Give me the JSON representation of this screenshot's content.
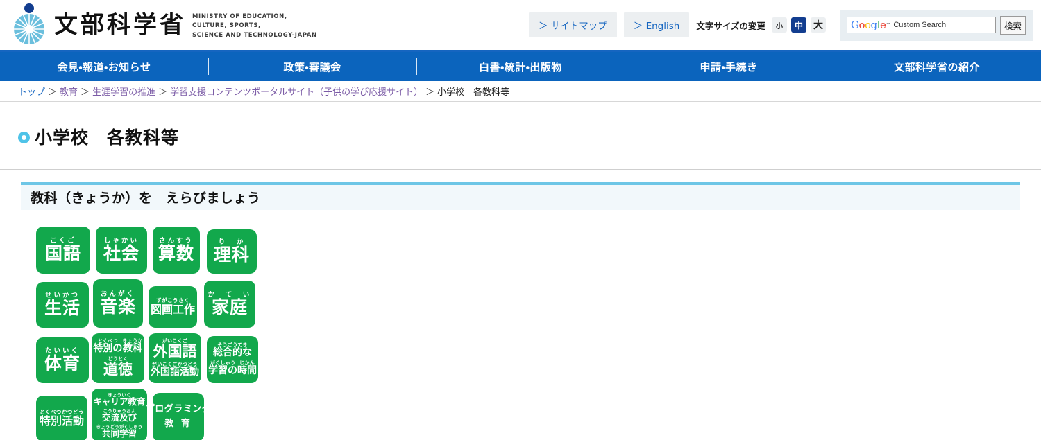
{
  "header": {
    "logo_jp": "文部科学省",
    "logo_en_lines": [
      "MINISTRY OF EDUCATION,",
      "CULTURE, SPORTS,",
      "SCIENCE AND TECHNOLOGY-JAPAN"
    ],
    "sitemap_label": "＞ サイトマップ",
    "english_label": "＞ English",
    "fontsize_label": "文字サイズの変更",
    "fontsize_options": [
      {
        "label": "小",
        "active": false
      },
      {
        "label": "中",
        "active": true
      },
      {
        "label": "大",
        "active": false
      }
    ],
    "search": {
      "brand": "Google",
      "trademark": "™",
      "custom_search_label": "Custom Search",
      "input_value": "",
      "placeholder": "",
      "button_label": "検索"
    },
    "accent_blue": "#0b64bd",
    "active_navy": "#123d8f"
  },
  "gnav": {
    "items": [
      {
        "label": "会見・報道・お知らせ"
      },
      {
        "label": "政策・審議会"
      },
      {
        "label": "白書・統計・出版物"
      },
      {
        "label": "申請・手続き"
      },
      {
        "label": "文部科学省の紹介"
      }
    ]
  },
  "breadcrumb": {
    "separator": "＞",
    "items": [
      {
        "label": "トップ",
        "link": true,
        "visited": false
      },
      {
        "label": "教育",
        "link": true,
        "visited": true
      },
      {
        "label": "生涯学習の推進",
        "link": true,
        "visited": true
      },
      {
        "label": "学習支援コンテンツポータルサイト（子供の学び応援サイト）",
        "link": true,
        "visited": true
      },
      {
        "label": "小学校　各教科等",
        "link": false,
        "visited": false
      }
    ]
  },
  "page": {
    "title": "小学校　各教科等",
    "section_heading": "教科（きょうか）を　えらびましょう",
    "tile_color": "#12a84c",
    "bullet_color": "#4fc3e8",
    "section_border_color": "#6ec6e6"
  },
  "subjects": {
    "rows": [
      [
        {
          "name": "国語",
          "ruby": "こくご",
          "width": 78,
          "height": 68,
          "size": "s-xl",
          "lines": [
            {
              "text": "国語",
              "ruby": "こくご"
            }
          ]
        },
        {
          "name": "社会",
          "ruby": "しゃかい",
          "width": 74,
          "height": 68,
          "size": "s-xl",
          "lines": [
            {
              "text": "社会",
              "ruby": "しゃかい"
            }
          ]
        },
        {
          "name": "算数",
          "ruby": "さんすう",
          "width": 68,
          "height": 68,
          "size": "s-xl",
          "lines": [
            {
              "text": "算数",
              "ruby": "さんすう"
            }
          ]
        },
        {
          "name": "理科",
          "ruby": "りか",
          "width": 72,
          "height": 64,
          "size": "s-xl",
          "lines": [
            {
              "text": "理科",
              "ruby": "り　か"
            }
          ]
        }
      ],
      [
        {
          "name": "生活",
          "ruby": "せいかつ",
          "width": 76,
          "height": 66,
          "size": "s-xl",
          "lines": [
            {
              "text": "生活",
              "ruby": "せいかつ"
            }
          ]
        },
        {
          "name": "音楽",
          "ruby": "おんがく",
          "width": 72,
          "height": 70,
          "size": "s-xl",
          "lines": [
            {
              "text": "音楽",
              "ruby": "おんがく"
            }
          ]
        },
        {
          "name": "図画工作",
          "ruby": "ずがこうさく",
          "width": 70,
          "height": 60,
          "size": "s-md",
          "lines": [
            {
              "text": "図画工作",
              "ruby": "ずがこうさく"
            }
          ]
        },
        {
          "name": "家庭",
          "ruby": "かてい",
          "width": 74,
          "height": 68,
          "size": "s-xl",
          "lines": [
            {
              "text": "家庭",
              "ruby": "か　て　い"
            }
          ]
        }
      ],
      [
        {
          "name": "体育",
          "ruby": "たいいく",
          "width": 76,
          "height": 66,
          "size": "s-xl",
          "lines": [
            {
              "text": "体育",
              "ruby": "たいいく"
            }
          ]
        },
        {
          "name": "特別の教科 道徳",
          "ruby": "とくべつのきょうか どうとく",
          "width": 76,
          "height": 72,
          "size": "s-sm",
          "lines": [
            {
              "text": "特別の教科",
              "ruby": "とくべつ・きょうか"
            },
            {
              "text": "道徳",
              "ruby": "どうとく",
              "big": true
            }
          ]
        },
        {
          "name": "外国語・外国語活動",
          "ruby": "がいこくご・がいこくごかつどう",
          "width": 76,
          "height": 72,
          "size": "s-sm",
          "lines": [
            {
              "text": "外国語",
              "ruby": "がいこくご",
              "big": true
            },
            {
              "text": "外国語活動",
              "ruby": "がいこくごかつどう"
            }
          ]
        },
        {
          "name": "総合的な学習の時間",
          "ruby": "そうごうてき がくしゅう じかん",
          "width": 74,
          "height": 68,
          "size": "s-sm",
          "lines": [
            {
              "text": "総合的な",
              "ruby": "そうごうてき"
            },
            {
              "text": "学習の時間",
              "ruby": "がくしゅう　じかん"
            }
          ]
        }
      ],
      [
        {
          "name": "特別活動",
          "ruby": "とくべつかつどう",
          "width": 74,
          "height": 66,
          "size": "s-md",
          "lines": [
            {
              "text": "特別活動",
              "ruby": "とくべつかつどう"
            }
          ]
        },
        {
          "name": "キャリア教育 交流及び共同学習",
          "ruby": "きょういく こうりゅうおよ きょうどうがくしゅう",
          "width": 80,
          "height": 76,
          "size": "s-xs",
          "lines": [
            {
              "text": "キャリア教育",
              "ruby": "きょういく"
            },
            {
              "text": "交流及び",
              "ruby": "こうりゅうおよ"
            },
            {
              "text": "共同学習",
              "ruby": "きょうどうがくしゅう"
            }
          ]
        },
        {
          "name": "プログラミング教育",
          "ruby": "",
          "width": 74,
          "height": 70,
          "size": "prog",
          "lines": [
            {
              "text": "プログラミング"
            },
            {
              "text": "教 育",
              "second": true
            }
          ]
        }
      ]
    ]
  }
}
